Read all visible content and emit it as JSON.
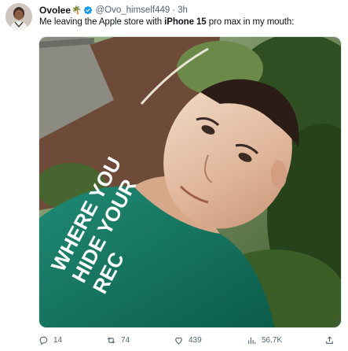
{
  "tweet": {
    "display_name": "Ovolee",
    "name_emoji": "🌴",
    "handle": "@Ovo_himself449",
    "separator": "·",
    "time": "3h",
    "text_before": "Me leaving the Apple store with ",
    "text_bold": "iPhone 15",
    "text_after": " pro max in my mouth:",
    "shirt_text": [
      "WHERE YOU",
      "HIDE YOUR",
      "REC"
    ]
  },
  "actions": {
    "replies": "14",
    "reposts": "74",
    "likes": "439",
    "views": "56.7K"
  },
  "icons": {
    "reply": "comment-icon",
    "repost": "repost-icon",
    "like": "heart-icon",
    "views": "views-chart-icon",
    "share": "share-icon",
    "verified": "verified-badge-icon"
  },
  "colors": {
    "verified": "#1d9bf0",
    "muted": "#536471",
    "text": "#0f1419"
  }
}
